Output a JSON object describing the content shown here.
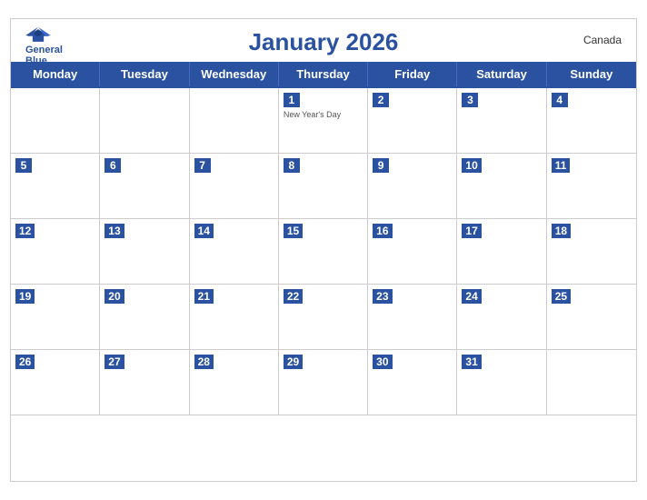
{
  "header": {
    "title": "January 2026",
    "country": "Canada",
    "logo_text_line1": "General",
    "logo_text_line2": "Blue"
  },
  "day_headers": [
    "Monday",
    "Tuesday",
    "Wednesday",
    "Thursday",
    "Friday",
    "Saturday",
    "Sunday"
  ],
  "weeks": [
    [
      {
        "date": "",
        "empty": true
      },
      {
        "date": "",
        "empty": true
      },
      {
        "date": "",
        "empty": true
      },
      {
        "date": "1",
        "event": "New Year's Day"
      },
      {
        "date": "2"
      },
      {
        "date": "3"
      },
      {
        "date": "4"
      }
    ],
    [
      {
        "date": "5"
      },
      {
        "date": "6"
      },
      {
        "date": "7"
      },
      {
        "date": "8"
      },
      {
        "date": "9"
      },
      {
        "date": "10"
      },
      {
        "date": "11"
      }
    ],
    [
      {
        "date": "12"
      },
      {
        "date": "13"
      },
      {
        "date": "14"
      },
      {
        "date": "15"
      },
      {
        "date": "16"
      },
      {
        "date": "17"
      },
      {
        "date": "18"
      }
    ],
    [
      {
        "date": "19"
      },
      {
        "date": "20"
      },
      {
        "date": "21"
      },
      {
        "date": "22"
      },
      {
        "date": "23"
      },
      {
        "date": "24"
      },
      {
        "date": "25"
      }
    ],
    [
      {
        "date": "26"
      },
      {
        "date": "27"
      },
      {
        "date": "28"
      },
      {
        "date": "29"
      },
      {
        "date": "30"
      },
      {
        "date": "31"
      },
      {
        "date": "",
        "empty": true
      }
    ]
  ],
  "colors": {
    "header_blue": "#2a52a0",
    "border": "#cccccc",
    "text_white": "#ffffff",
    "event_text": "#555555"
  }
}
